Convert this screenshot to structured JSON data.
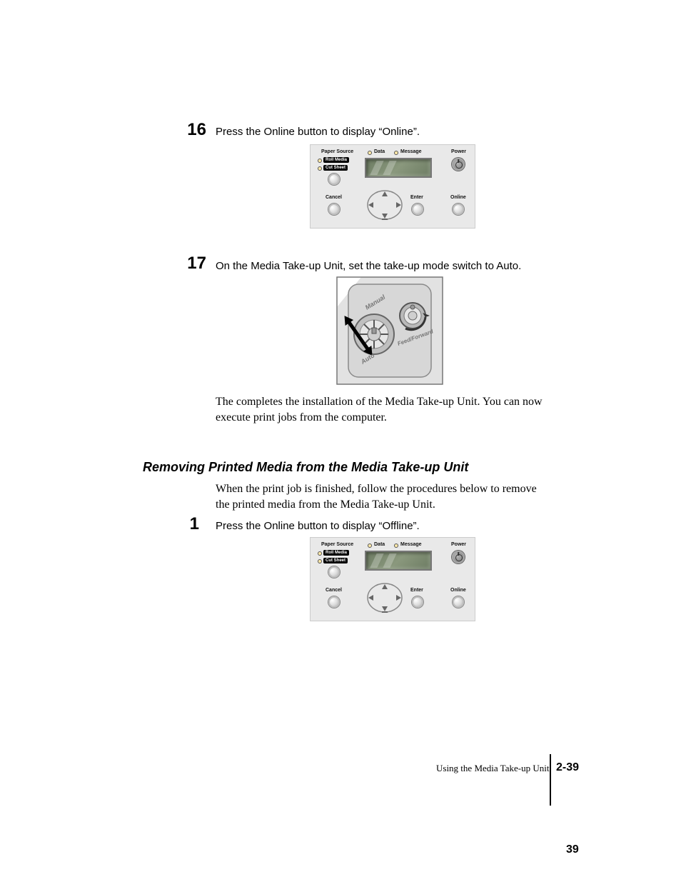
{
  "steps": {
    "s16": {
      "num": "16",
      "text": "Press the Online button to display “Online”."
    },
    "s17": {
      "num": "17",
      "text": "On the Media Take-up Unit, set the take-up mode switch to Auto."
    },
    "s1": {
      "num": "1",
      "text": "Press the Online button to display “Offline”."
    }
  },
  "paragraphs": {
    "completion": "The completes the installation of the Media Take-up Unit. You can now execute print jobs from the computer.",
    "removal_intro": "When the print job is finished, follow the procedures below to remove the printed media from the Media Take-up Unit."
  },
  "section_heading": "Removing Printed Media from the Media Take-up Unit",
  "panel_labels": {
    "paper_source": "Paper Source",
    "roll_media": "Roll Media",
    "cut_sheet": "Cut Sheet",
    "cancel": "Cancel",
    "data": "Data",
    "message": "Message",
    "power": "Power",
    "enter": "Enter",
    "online": "Online"
  },
  "switch_labels": {
    "manual": "Manual",
    "auto": "Auto",
    "feed_forward": "Feed/Forward"
  },
  "footer": {
    "section": "Using the Media Take-up Unit",
    "page": "2-39",
    "seq": "39"
  }
}
